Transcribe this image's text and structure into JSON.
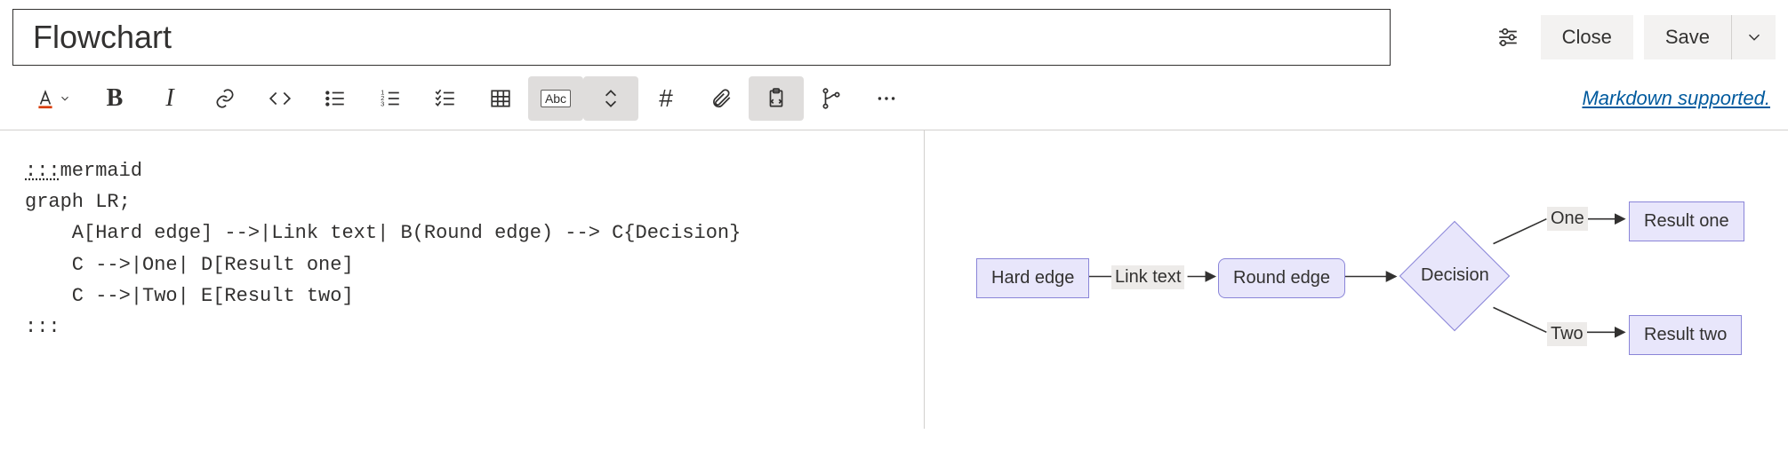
{
  "header": {
    "title_value": "Flowchart",
    "close_label": "Close",
    "save_label": "Save"
  },
  "toolbar": {
    "abc_label": "Abc",
    "hash_label": "#",
    "markdown_link": "Markdown supported."
  },
  "editor": {
    "line1_open": ":::",
    "line1_lang": "mermaid",
    "line2": "graph LR;",
    "line3": "    A[Hard edge] -->|Link text| B(Round edge) --> C{Decision}",
    "line4": "    C -->|One| D[Result one]",
    "line5": "    C -->|Two| E[Result two]",
    "line6": ":::"
  },
  "flowchart": {
    "node_a": "Hard edge",
    "node_b": "Round edge",
    "node_c": "Decision",
    "node_d": "Result one",
    "node_e": "Result two",
    "edge_ab": "Link text",
    "edge_cd": "One",
    "edge_ce": "Two"
  }
}
